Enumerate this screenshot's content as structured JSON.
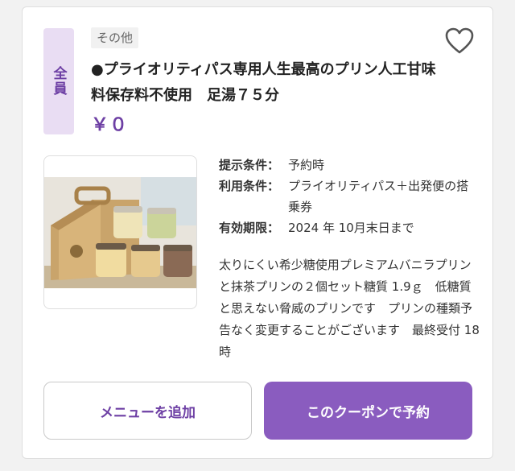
{
  "coupon": {
    "audience_badge": "全員",
    "category": "その他",
    "title": "●プライオリティパス専用人生最高のプリン人工甘味料保存料不使用　足湯７５分",
    "price": "￥０",
    "favorite_icon": "heart-outline-icon",
    "conditions": [
      {
        "label": "提示条件：",
        "value": "予約時"
      },
      {
        "label": "利用条件：",
        "value": "プライオリティパス＋出発便の搭乗券"
      },
      {
        "label": "有効期限：",
        "value": "2024 年 10月末日まで"
      }
    ],
    "description": "太りにくい希少糖使用プレミアムバニラプリンと抹茶プリンの２個セット糖質 1.9ｇ　低糖質と思えない脅威のプリンです　プリンの種類予告なく変更することがございます　最終受付 18 時",
    "buttons": {
      "add_menu": "メニューを追加",
      "reserve": "このクーポンで予約"
    }
  },
  "colors": {
    "accent": "#6d3fa4",
    "button_fill": "#8a5cbf",
    "badge_bg": "#e9ddf3"
  }
}
